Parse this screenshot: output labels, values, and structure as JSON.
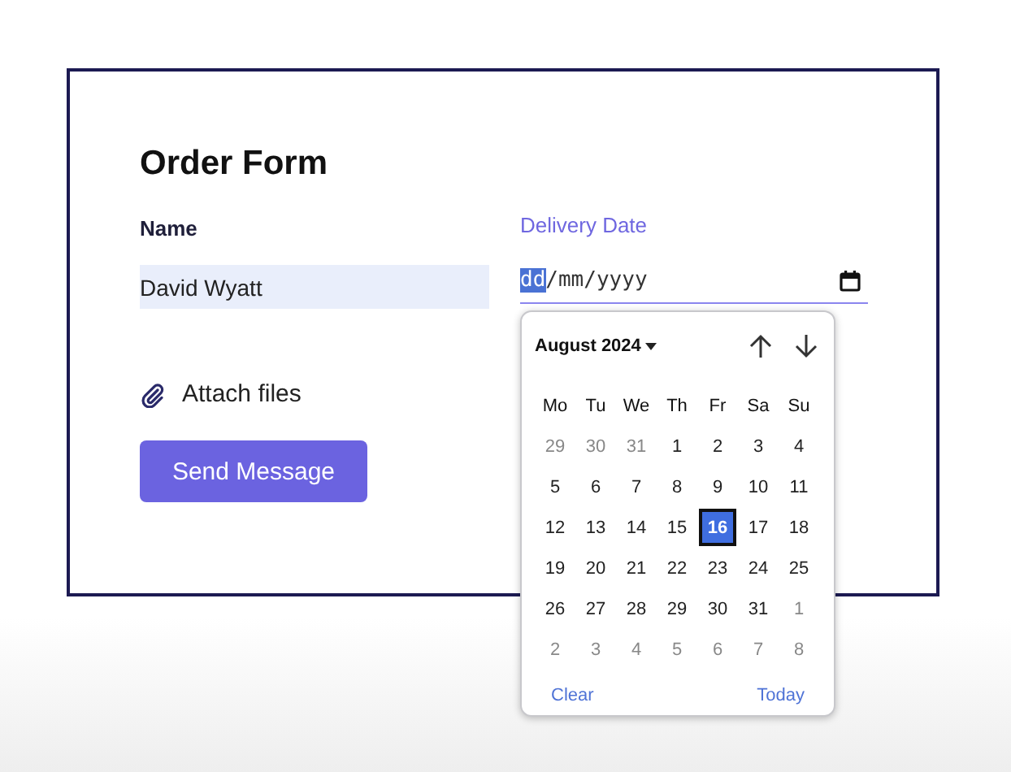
{
  "form": {
    "title": "Order Form",
    "name_field": {
      "label": "Name",
      "value": "David Wyatt"
    },
    "date_field": {
      "label": "Delivery Date",
      "parts": [
        {
          "text": "dd",
          "selected": true
        },
        {
          "text": "/",
          "selected": false
        },
        {
          "text": "mm",
          "selected": false
        },
        {
          "text": "/",
          "selected": false
        },
        {
          "text": "yyyy",
          "selected": false
        }
      ]
    },
    "attach": {
      "label": "Attach files"
    },
    "submit": {
      "label": "Send Message"
    }
  },
  "calendar": {
    "month": "August 2024",
    "weekdays": [
      "Mo",
      "Tu",
      "We",
      "Th",
      "Fr",
      "Sa",
      "Su"
    ],
    "days": [
      {
        "text": "29",
        "muted": true,
        "selected": false
      },
      {
        "text": "30",
        "muted": true,
        "selected": false
      },
      {
        "text": "31",
        "muted": true,
        "selected": false
      },
      {
        "text": "1",
        "muted": false,
        "selected": false
      },
      {
        "text": "2",
        "muted": false,
        "selected": false
      },
      {
        "text": "3",
        "muted": false,
        "selected": false
      },
      {
        "text": "4",
        "muted": false,
        "selected": false
      },
      {
        "text": "5",
        "muted": false,
        "selected": false
      },
      {
        "text": "6",
        "muted": false,
        "selected": false
      },
      {
        "text": "7",
        "muted": false,
        "selected": false
      },
      {
        "text": "8",
        "muted": false,
        "selected": false
      },
      {
        "text": "9",
        "muted": false,
        "selected": false
      },
      {
        "text": "10",
        "muted": false,
        "selected": false
      },
      {
        "text": "11",
        "muted": false,
        "selected": false
      },
      {
        "text": "12",
        "muted": false,
        "selected": false
      },
      {
        "text": "13",
        "muted": false,
        "selected": false
      },
      {
        "text": "14",
        "muted": false,
        "selected": false
      },
      {
        "text": "15",
        "muted": false,
        "selected": false
      },
      {
        "text": "16",
        "muted": false,
        "selected": true
      },
      {
        "text": "17",
        "muted": false,
        "selected": false
      },
      {
        "text": "18",
        "muted": false,
        "selected": false
      },
      {
        "text": "19",
        "muted": false,
        "selected": false
      },
      {
        "text": "20",
        "muted": false,
        "selected": false
      },
      {
        "text": "21",
        "muted": false,
        "selected": false
      },
      {
        "text": "22",
        "muted": false,
        "selected": false
      },
      {
        "text": "23",
        "muted": false,
        "selected": false
      },
      {
        "text": "24",
        "muted": false,
        "selected": false
      },
      {
        "text": "25",
        "muted": false,
        "selected": false
      },
      {
        "text": "26",
        "muted": false,
        "selected": false
      },
      {
        "text": "27",
        "muted": false,
        "selected": false
      },
      {
        "text": "28",
        "muted": false,
        "selected": false
      },
      {
        "text": "29",
        "muted": false,
        "selected": false
      },
      {
        "text": "30",
        "muted": false,
        "selected": false
      },
      {
        "text": "31",
        "muted": false,
        "selected": false
      },
      {
        "text": "1",
        "muted": true,
        "selected": false
      },
      {
        "text": "2",
        "muted": true,
        "selected": false
      },
      {
        "text": "3",
        "muted": true,
        "selected": false
      },
      {
        "text": "4",
        "muted": true,
        "selected": false
      },
      {
        "text": "5",
        "muted": true,
        "selected": false
      },
      {
        "text": "6",
        "muted": true,
        "selected": false
      },
      {
        "text": "7",
        "muted": true,
        "selected": false
      },
      {
        "text": "8",
        "muted": true,
        "selected": false
      }
    ],
    "clear": "Clear",
    "today": "Today"
  }
}
